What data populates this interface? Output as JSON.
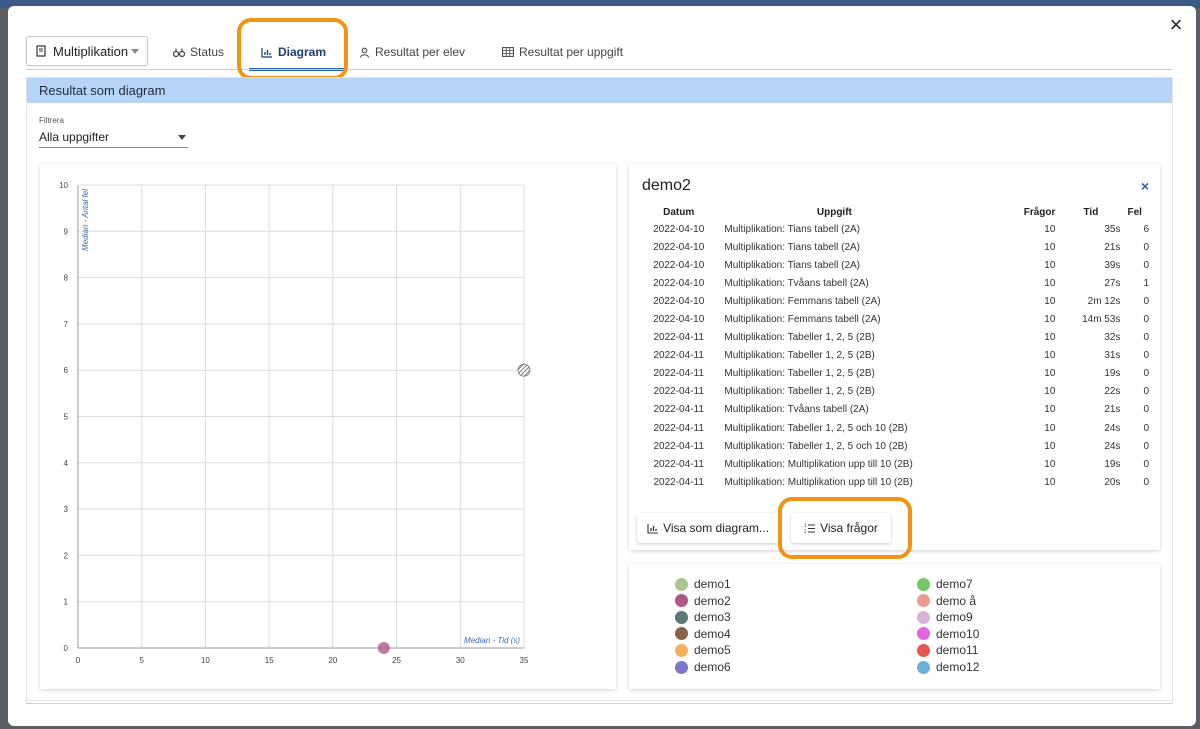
{
  "modal": {
    "close_symbol": "×"
  },
  "subject_select": {
    "value": "Multiplikation"
  },
  "tabs": [
    {
      "label": "Status",
      "icon": "binoculars-icon"
    },
    {
      "label": "Diagram",
      "icon": "bar-chart-icon"
    },
    {
      "label": "Resultat per elev",
      "icon": "person-icon"
    },
    {
      "label": "Resultat per uppgift",
      "icon": "table-icon"
    }
  ],
  "section": {
    "title": "Resultat som diagram"
  },
  "filter": {
    "label": "Filtrera",
    "value": "Alla uppgifter"
  },
  "chart_data": {
    "type": "scatter",
    "xlabel": "Median - Tid (s)",
    "ylabel": "Median - Antal fel",
    "xlim": [
      0,
      35
    ],
    "ylim": [
      0,
      10
    ],
    "xticks": [
      0,
      5,
      10,
      15,
      20,
      25,
      30,
      35
    ],
    "yticks": [
      0,
      1,
      2,
      3,
      4,
      5,
      6,
      7,
      8,
      9,
      10
    ],
    "grid": true,
    "series": [
      {
        "name": "demo2",
        "color": "#b0578a",
        "points": [
          {
            "x": 24,
            "y": 0
          }
        ],
        "hatched": false
      },
      {
        "name": "demo1",
        "color": "#6b6b6b",
        "points": [
          {
            "x": 35,
            "y": 6
          }
        ],
        "hatched": true
      }
    ]
  },
  "detail": {
    "title": "demo2",
    "close_symbol": "×",
    "columns": [
      "Datum",
      "Uppgift",
      "Frågor",
      "Tid",
      "Fel"
    ],
    "rows": [
      [
        "2022-04-10",
        "Multiplikation: Tians tabell (2A)",
        "10",
        "35s",
        "6"
      ],
      [
        "2022-04-10",
        "Multiplikation: Tians tabell (2A)",
        "10",
        "21s",
        "0"
      ],
      [
        "2022-04-10",
        "Multiplikation: Tians tabell (2A)",
        "10",
        "39s",
        "0"
      ],
      [
        "2022-04-10",
        "Multiplikation: Tvåans tabell (2A)",
        "10",
        "27s",
        "1"
      ],
      [
        "2022-04-10",
        "Multiplikation: Femmans tabell (2A)",
        "10",
        "2m 12s",
        "0"
      ],
      [
        "2022-04-10",
        "Multiplikation: Femmans tabell (2A)",
        "10",
        "14m 53s",
        "0"
      ],
      [
        "2022-04-11",
        "Multiplikation: Tabeller 1, 2, 5 (2B)",
        "10",
        "32s",
        "0"
      ],
      [
        "2022-04-11",
        "Multiplikation: Tabeller 1, 2, 5 (2B)",
        "10",
        "31s",
        "0"
      ],
      [
        "2022-04-11",
        "Multiplikation: Tabeller 1, 2, 5 (2B)",
        "10",
        "19s",
        "0"
      ],
      [
        "2022-04-11",
        "Multiplikation: Tabeller 1, 2, 5 (2B)",
        "10",
        "22s",
        "0"
      ],
      [
        "2022-04-11",
        "Multiplikation: Tvåans tabell (2A)",
        "10",
        "21s",
        "0"
      ],
      [
        "2022-04-11",
        "Multiplikation: Tabeller 1, 2, 5 och 10 (2B)",
        "10",
        "24s",
        "0"
      ],
      [
        "2022-04-11",
        "Multiplikation: Tabeller 1, 2, 5 och 10 (2B)",
        "10",
        "24s",
        "0"
      ],
      [
        "2022-04-11",
        "Multiplikation: Multiplikation upp till 10 (2B)",
        "10",
        "19s",
        "0"
      ],
      [
        "2022-04-11",
        "Multiplikation: Multiplikation upp till 10 (2B)",
        "10",
        "20s",
        "0"
      ]
    ],
    "buttons": {
      "show_as_diagram": "Visa som diagram...",
      "show_questions": "Visa frågor"
    }
  },
  "legend": [
    {
      "name": "demo1",
      "color": "#a9c68f"
    },
    {
      "name": "demo2",
      "color": "#b0578a"
    },
    {
      "name": "demo3",
      "color": "#5e7676"
    },
    {
      "name": "demo4",
      "color": "#8a6248"
    },
    {
      "name": "demo5",
      "color": "#f6b05c"
    },
    {
      "name": "demo6",
      "color": "#7b76c8"
    },
    {
      "name": "demo7",
      "color": "#72c963"
    },
    {
      "name": "demo å",
      "color": "#ee9b8f"
    },
    {
      "name": "demo9",
      "color": "#dbb2d8"
    },
    {
      "name": "demo10",
      "color": "#e363e1"
    },
    {
      "name": "demo11",
      "color": "#e4584f"
    },
    {
      "name": "demo12",
      "color": "#6aaedf"
    }
  ]
}
